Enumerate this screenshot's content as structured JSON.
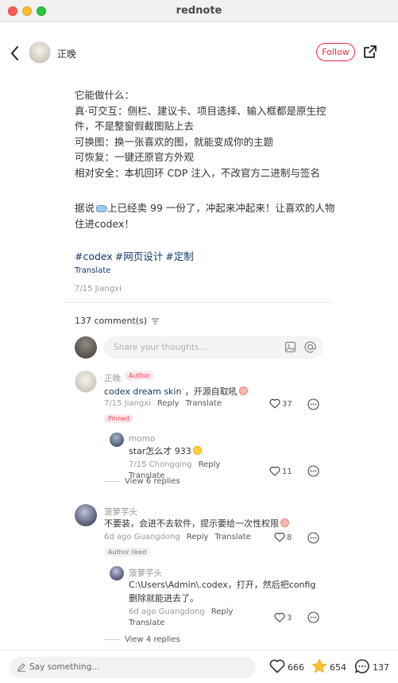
{
  "window": {
    "title": "rednote"
  },
  "header": {
    "author_name": "正晚",
    "follow_label": "Follow"
  },
  "note": {
    "paragraph1": "它能做什么：\n真·可交互：侧栏、建议卡、项目选择、输入框都是原生控件，不是整窗假截图贴上去\n可换图：换一张喜欢的图，就能变成你的主题\n可恢复：一键还原官方外观\n相对安全：本机回环 CDP 注入，不改官方二进制与签名",
    "paragraph2_prefix": "据说",
    "paragraph2_suffix": "上已经卖 99 一份了，冲起来冲起来！让喜欢的人物住进codex！",
    "tags": [
      "#codex",
      "#网页设计",
      "#定制"
    ],
    "translate_label": "Translate",
    "date_location": "7/15 Jiangxi"
  },
  "comments_section": {
    "count_label": "137 comment(s)",
    "input_placeholder": "Share your thoughts..."
  },
  "comments": {
    "c1": {
      "name": "正晚",
      "badge": "Author",
      "text_link": "codex dream skin",
      "text_rest": "，开源自取吼",
      "meta": "7/15 Jiangxi",
      "reply": "Reply",
      "translate": "Translate",
      "likes": "37",
      "badge2": "Pinned"
    },
    "c1r1": {
      "name": "momo",
      "text": "star怎么才 933",
      "meta": "7/15 Chongqing",
      "reply": "Reply",
      "translate": "Translate",
      "likes": "11"
    },
    "c1_view": "View 6 replies",
    "c2": {
      "name": "菠萝芋头",
      "text": "不要装，会进不去软件，提示要给一次性权限",
      "meta": "6d ago Guangdong",
      "reply": "Reply",
      "translate": "Translate",
      "likes": "8",
      "badge": "Author liked"
    },
    "c2r1": {
      "name": "菠萝芋头",
      "text": "C:\\Users\\Admin\\.codex，打开，然后把config删除就能进去了。",
      "meta": "6d ago Guangdong",
      "reply": "Reply",
      "translate": "Translate",
      "likes": "3"
    },
    "c2_view": "View 4 replies"
  },
  "bottom_bar": {
    "placeholder": "Say something...",
    "likes": "666",
    "collects": "654",
    "comments": "137"
  },
  "colors": {
    "accent": "#ff2442",
    "link": "#13386c",
    "star": "#fbc02d"
  }
}
